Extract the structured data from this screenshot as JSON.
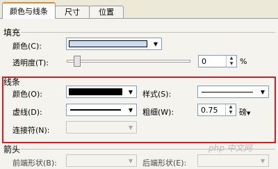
{
  "tabs": [
    {
      "label": "颜色与线条",
      "active": true
    },
    {
      "label": "尺寸",
      "active": false
    },
    {
      "label": "位置",
      "active": false
    }
  ],
  "fill": {
    "title": "填充",
    "color_label": "颜色(C):",
    "color_value": "#c9dcf2",
    "transparency_label": "透明度(T):",
    "transparency_fraction": 0.0,
    "transparency_value": "0",
    "percent_symbol": "%"
  },
  "line": {
    "title": "线条",
    "color_label": "颜色(O):",
    "color_value": "#000000",
    "style_label": "样式(S):",
    "dash_label": "虚线(D):",
    "weight_label": "粗细(W):",
    "weight_value": "0.75",
    "weight_unit": "磅",
    "connector_label": "连接符(N):"
  },
  "arrows": {
    "title": "箭头",
    "begin_style_label": "前端形状(B):",
    "end_style_label": "后端形状(E):"
  },
  "watermark": "php 中文网",
  "colors": {
    "highlight_border": "#d71920"
  }
}
